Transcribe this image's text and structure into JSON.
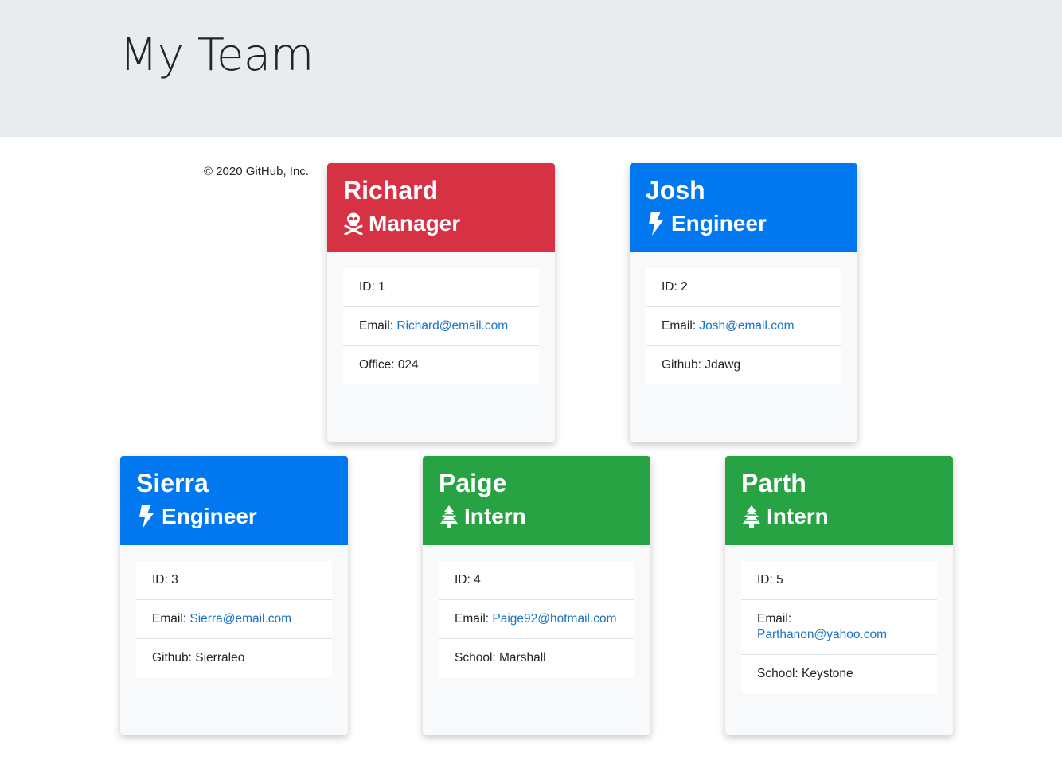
{
  "header": {
    "title": "My Team"
  },
  "footer": {
    "copyright": "© 2020 GitHub, Inc."
  },
  "colors": {
    "manager": "#d63244",
    "engineer": "#0278f0",
    "intern": "#28a344",
    "link": "#1a73c8"
  },
  "cards": [
    {
      "name": "Richard",
      "role": "Manager",
      "icon": "skull-crossbones-icon",
      "id_label": "ID: 1",
      "email_label": "Email: ",
      "email": "Richard@email.com",
      "extra": "Office: 024"
    },
    {
      "name": "Josh",
      "role": "Engineer",
      "icon": "bolt-icon",
      "id_label": "ID: 2",
      "email_label": "Email: ",
      "email": "Josh@email.com",
      "extra": "Github: Jdawg"
    },
    {
      "name": "Sierra",
      "role": "Engineer",
      "icon": "bolt-icon",
      "id_label": "ID: 3",
      "email_label": "Email: ",
      "email": "Sierra@email.com",
      "extra": "Github: Sierraleo"
    },
    {
      "name": "Paige",
      "role": "Intern",
      "icon": "tree-icon",
      "id_label": "ID: 4",
      "email_label": "Email: ",
      "email": "Paige92@hotmail.com",
      "extra": "School: Marshall"
    },
    {
      "name": "Parth",
      "role": "Intern",
      "icon": "tree-icon",
      "id_label": "ID: 5",
      "email_label": "Email: ",
      "email": "Parthanon@yahoo.com",
      "extra": "School: Keystone"
    }
  ]
}
